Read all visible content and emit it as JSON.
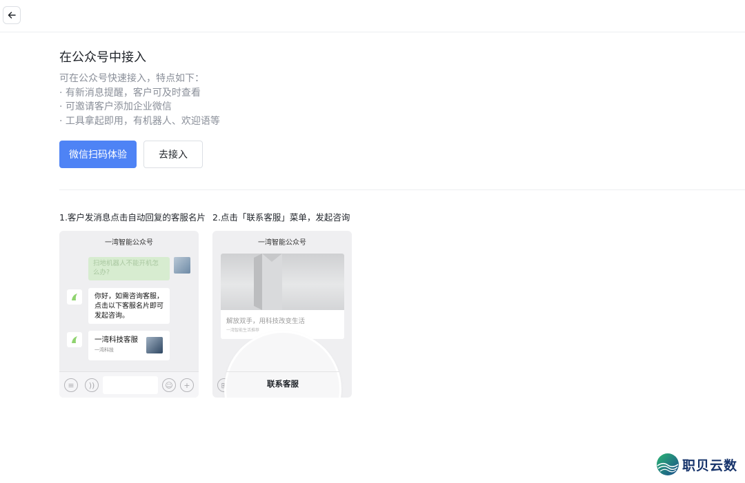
{
  "header": {
    "back_icon": "arrow-left-icon"
  },
  "section": {
    "title": "在公众号中接入",
    "intro": "可在公众号快速接入，特点如下：",
    "features": [
      "· 有新消息提醒，客户可及时查看",
      "· 可邀请客户添加企业微信",
      "· 工具拿起即用，有机器人、欢迎语等"
    ],
    "primary_button": "微信扫码体验",
    "secondary_button": "去接入"
  },
  "steps": [
    {
      "label": "1.客户发消息点击自动回复的客服名片",
      "phone_title": "一湾智能公众号",
      "user_message": "扫地机器人不能开机怎么办?",
      "bot_reply": "你好，如需咨询客服，点击以下客服名片即可发起咨询。",
      "card_title": "一湾科技客服",
      "card_subtitle": "一湾科技"
    },
    {
      "label": "2.点击「联系客服」菜单，发起咨询",
      "phone_title": "一湾智能公众号",
      "article_title": "解放双手，用科技改变生活",
      "article_subtitle": "一湾智能生活推荐",
      "menu_label": "联系客服"
    }
  ],
  "watermark": {
    "text": "职贝云数"
  },
  "colors": {
    "primary": "#4e83f5",
    "chat_green": "#d7ecd0",
    "text": "#1f2329",
    "muted": "#8a8f99"
  }
}
